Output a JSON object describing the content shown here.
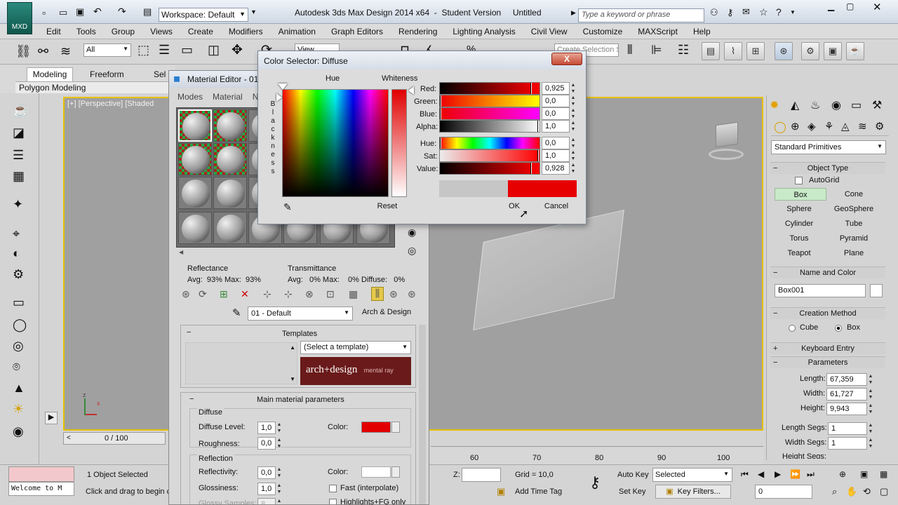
{
  "titlebar": {
    "logo": "MXD",
    "workspace": "Workspace: Default",
    "title": "Autodesk 3ds Max Design 2014 x64  -  Student Version     Untitled",
    "search_placeholder": "Type a keyword or phrase"
  },
  "menu": [
    "Edit",
    "Tools",
    "Group",
    "Views",
    "Create",
    "Modifiers",
    "Animation",
    "Graph Editors",
    "Rendering",
    "Lighting Analysis",
    "Civil View",
    "Customize",
    "MAXScript",
    "Help"
  ],
  "main_toolbar": {
    "filter": "All",
    "view": "View",
    "selection_set": "Create Selection Se"
  },
  "ribbon": {
    "tabs": [
      "Modeling",
      "Freeform",
      "Sel"
    ],
    "panel": "Polygon Modeling"
  },
  "viewport": {
    "label": "[+] [Perspective] [Shaded"
  },
  "timeline": {
    "frame": "0 / 100",
    "ticks": [
      "60",
      "70",
      "80",
      "90",
      "100"
    ]
  },
  "status": {
    "listener": "Welcome to M",
    "selected": "1 Object Selected",
    "prompt": "Click and drag to begin c",
    "z_label": "Z:",
    "grid": "Grid = 10,0",
    "add_time_tag": "Add Time Tag",
    "auto_key": "Auto Key",
    "selected_dropdown": "Selected",
    "set_key": "Set Key",
    "key_filters": "Key Filters...",
    "frame_value": "0"
  },
  "command_panel": {
    "category": "Standard Primitives",
    "object_type": "Object Type",
    "autogrid": "AutoGrid",
    "primitives": [
      "Box",
      "Cone",
      "Sphere",
      "GeoSphere",
      "Cylinder",
      "Tube",
      "Torus",
      "Pyramid",
      "Teapot",
      "Plane"
    ],
    "name_and_color": "Name and Color",
    "object_name": "Box001",
    "creation_method": "Creation Method",
    "cube": "Cube",
    "box": "Box",
    "keyboard_entry": "Keyboard Entry",
    "parameters": "Parameters",
    "length_label": "Length:",
    "length": "67,359",
    "width_label": "Width:",
    "width": "61,727",
    "height_label": "Height:",
    "height": "9,943",
    "length_segs_label": "Length Segs:",
    "length_segs": "1",
    "width_segs_label": "Width Segs:",
    "width_segs": "1",
    "height_segs_label": "Height Segs:",
    "plus": "+",
    "minus": "−"
  },
  "material_editor": {
    "title": "Material Editor - 01",
    "menu": [
      "Modes",
      "Material",
      "N"
    ],
    "reflectance": "Reflectance",
    "reflectance_values": "Avg:  93% Max:  93%",
    "transmittance": "Transmittance",
    "transmittance_values": "Avg:   0% Max:    0% Diffuse:   0%",
    "material_name": "01 - Default",
    "material_type": "Arch & Design",
    "templates": "Templates",
    "template_select": "(Select a template)",
    "brand": "arch+design",
    "brand_sub": "mental ray",
    "main_params": "Main material parameters",
    "diffuse": "Diffuse",
    "diffuse_level_label": "Diffuse Level:",
    "diffuse_level": "1,0",
    "roughness_label": "Roughness:",
    "roughness": "0,0",
    "color_label": "Color:",
    "reflection": "Reflection",
    "reflectivity_label": "Reflectivity:",
    "reflectivity": "0,0",
    "glossiness_label": "Glossiness:",
    "glossiness": "1,0",
    "glossy_samples_label": "Glossy Samples:",
    "glossy_samples": "8",
    "fast_interpolate": "Fast (interpolate)",
    "highlights_fg": "Highlights+FG only",
    "minus": "−",
    "diffuse_color": "#e30000"
  },
  "color_selector": {
    "title": "Color Selector: Diffuse",
    "hue_label": "Hue",
    "whiteness_label": "Whiteness",
    "blackness_label": "Blackness",
    "red_label": "Red:",
    "red": "0,925",
    "green_label": "Green:",
    "green": "0,0",
    "blue_label": "Blue:",
    "blue": "0,0",
    "alpha_label": "Alpha:",
    "alpha": "1,0",
    "hue_val_label": "Hue:",
    "hue": "0,0",
    "sat_label": "Sat:",
    "sat": "1,0",
    "value_label": "Value:",
    "value": "0,928",
    "reset": "Reset",
    "ok": "OK",
    "cancel": "Cancel",
    "close": "X",
    "current_color": "#e60000",
    "old_color": "#c6c6c6"
  }
}
